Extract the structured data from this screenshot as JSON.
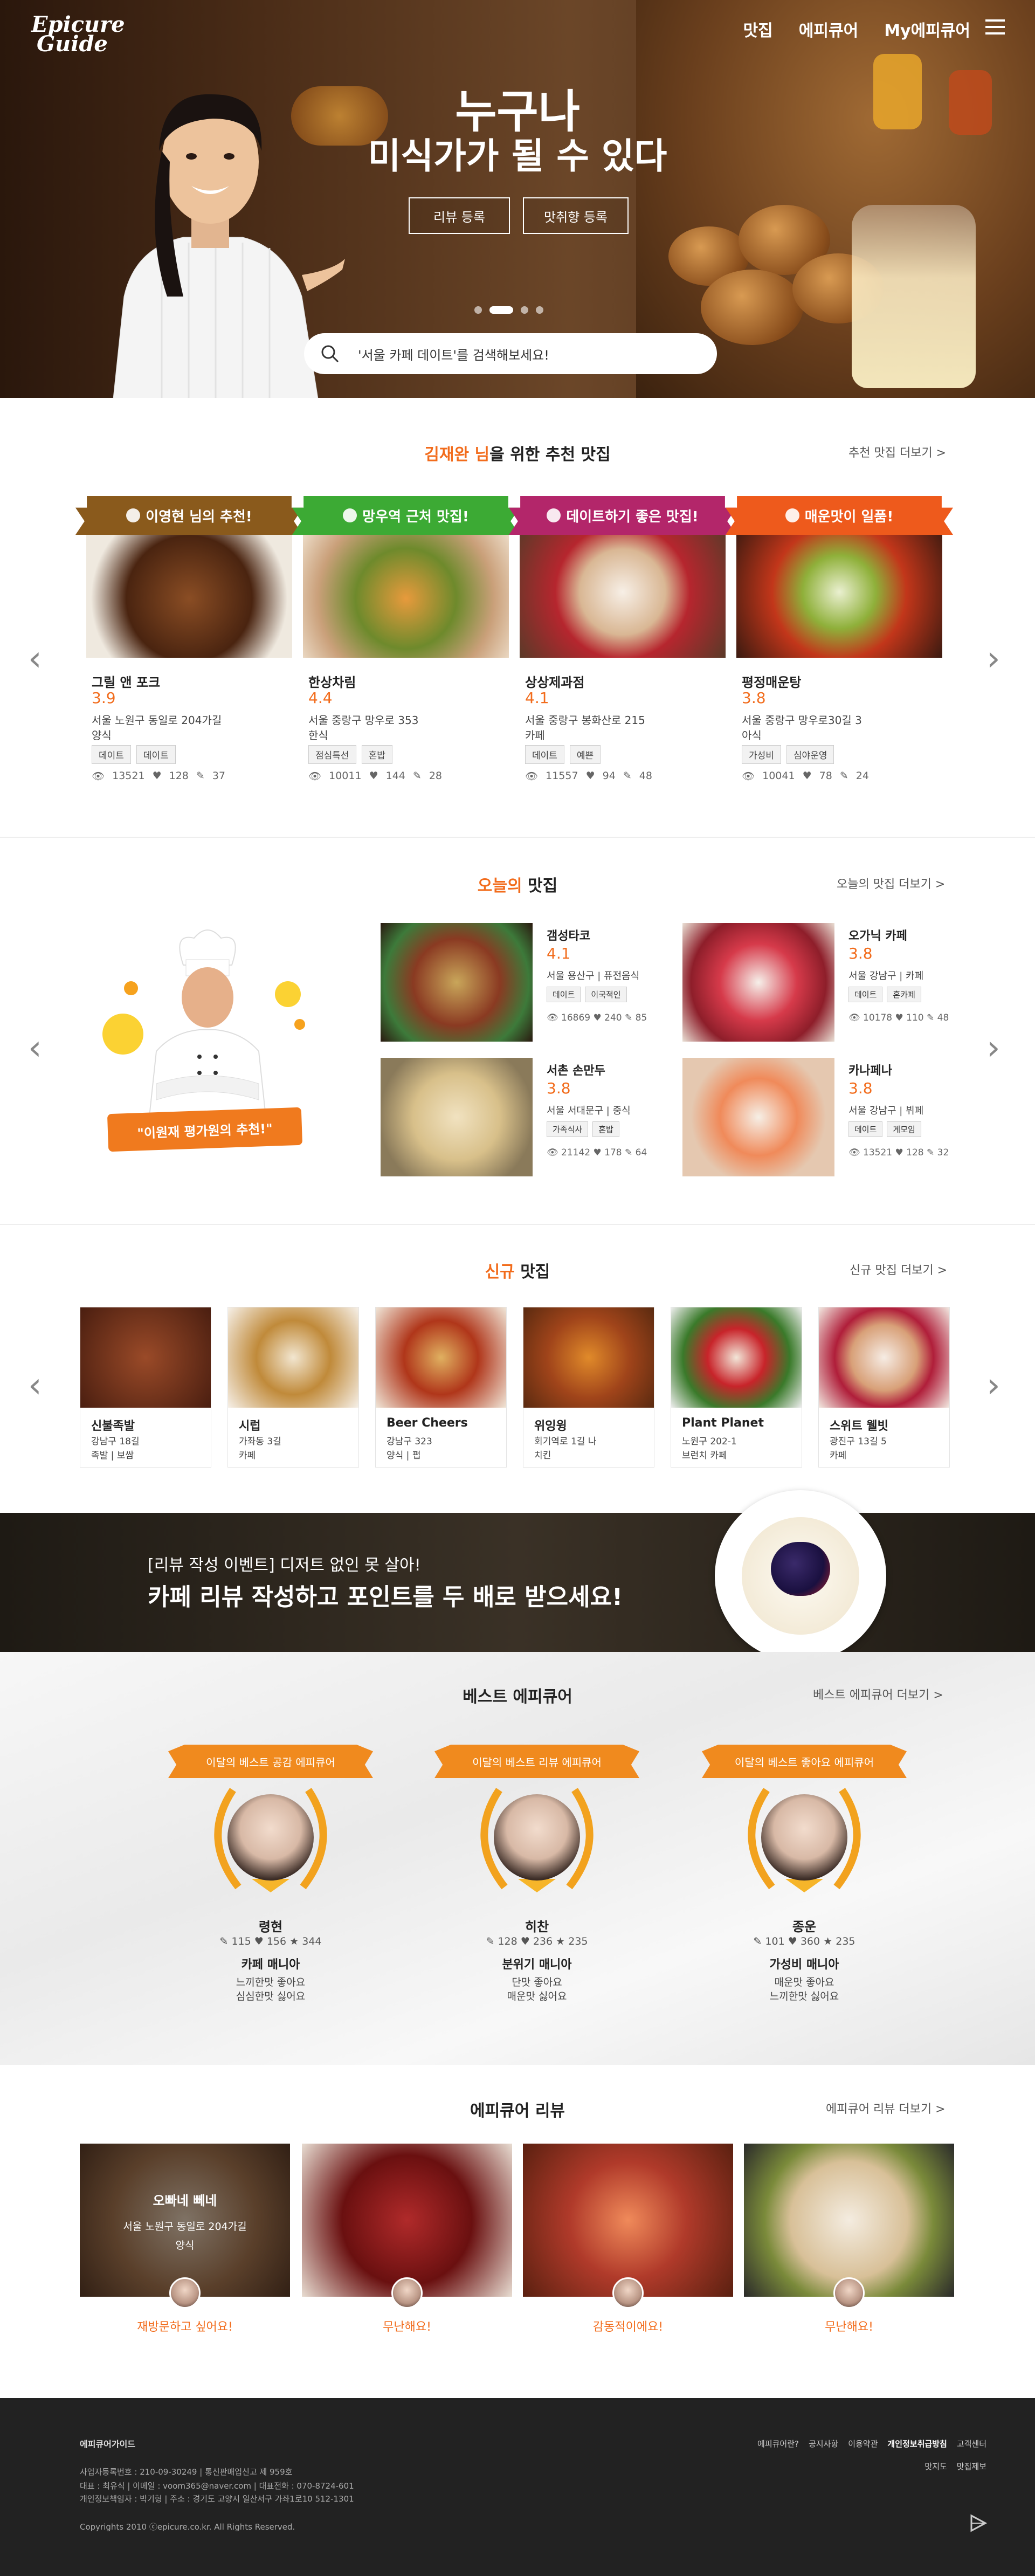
{
  "header": {
    "logo_line1": "Epicure",
    "logo_line2": "Guide",
    "nav": [
      "맛집",
      "에피큐어",
      "My에피큐어"
    ]
  },
  "hero": {
    "title1": "누구나",
    "title2": "미식가가 될 수 있다",
    "btn_review": "리뷰 등록",
    "btn_pref": "맛취향 등록",
    "search_placeholder": "'서울 카페 데이트'를 검색해보세요!"
  },
  "recommend": {
    "title_hl": "김재완 님",
    "title_rest": "을 위한 추천 맛집",
    "more": "추천 맛집 더보기 >",
    "cards": [
      {
        "ribbon": "이영현 님의 추천!",
        "ribbon_color": "#8a5a1c",
        "name": "그릴 앤 포크",
        "rating": "3.9",
        "addr": "서울 노원구 동일로 204가길",
        "cat": "양식",
        "tags": [
          "데이트",
          "데이트"
        ],
        "views": "13521",
        "likes": "128",
        "writes": "37"
      },
      {
        "ribbon": "망우역 근처 맛집!",
        "ribbon_color": "#3caa34",
        "name": "한상차림",
        "rating": "4.4",
        "addr": "서울 중랑구 망우로 353",
        "cat": "한식",
        "tags": [
          "점심특선",
          "혼밥"
        ],
        "views": "10011",
        "likes": "144",
        "writes": "28"
      },
      {
        "ribbon": "데이트하기 좋은 맛집!",
        "ribbon_color": "#b3266a",
        "name": "상상제과점",
        "rating": "4.1",
        "addr": "서울 중랑구 봉화산로 215",
        "cat": "카페",
        "tags": [
          "데이트",
          "예쁜"
        ],
        "views": "11557",
        "likes": "94",
        "writes": "48"
      },
      {
        "ribbon": "매운맛이 일품!",
        "ribbon_color": "#ee5a1c",
        "name": "평정매운탕",
        "rating": "3.8",
        "addr": "서울 중랑구 망우로30길 3",
        "cat": "아식",
        "tags": [
          "가성비",
          "심야운영"
        ],
        "views": "10041",
        "likes": "78",
        "writes": "24"
      }
    ]
  },
  "today": {
    "title_hl": "오늘의",
    "title_rest": " 맛집",
    "more": "오늘의 맛집 더보기 >",
    "chef_caption": "\"이원재 평가원의 추천!\"",
    "cards": [
      {
        "name": "갬성타코",
        "rating": "4.1",
        "addr": "서울 용산구 | 퓨전음식",
        "tags": [
          "데이트",
          "이국적인"
        ],
        "views": "16869",
        "likes": "240",
        "writes": "85"
      },
      {
        "name": "오가닉 카페",
        "rating": "3.8",
        "addr": "서울 강남구 | 카페",
        "tags": [
          "데이트",
          "혼카페"
        ],
        "views": "10178",
        "likes": "110",
        "writes": "48"
      },
      {
        "name": "서촌 손만두",
        "rating": "3.8",
        "addr": "서울 서대문구 | 중식",
        "tags": [
          "가족식사",
          "혼밥"
        ],
        "views": "21142",
        "likes": "178",
        "writes": "64"
      },
      {
        "name": "카나페나",
        "rating": "3.8",
        "addr": "서울 강남구 | 뷔페",
        "tags": [
          "데이트",
          "게모임"
        ],
        "views": "13521",
        "likes": "128",
        "writes": "32"
      }
    ]
  },
  "newest": {
    "title_hl": "신규",
    "title_rest": " 맛집",
    "more": "신규 맛집 더보기 >",
    "cards": [
      {
        "name": "신불족발",
        "addr": "강남구 18길",
        "cat": "족발 | 보쌈"
      },
      {
        "name": "시럽",
        "addr": "가좌동 3길",
        "cat": "카페"
      },
      {
        "name": "Beer Cheers",
        "addr": "강남구 323",
        "cat": "양식 | 펍"
      },
      {
        "name": "위잉윙",
        "addr": "회기역로 1길 나",
        "cat": "치킨"
      },
      {
        "name": "Plant Planet",
        "addr": "노원구 202-1",
        "cat": "브런치 카페"
      },
      {
        "name": "스위트 웰빗",
        "addr": "광진구 13길 5",
        "cat": "카페"
      }
    ]
  },
  "banner": {
    "sub": "[리뷰 작성 이벤트] 디저트 없인 못 살아!",
    "title": "카페 리뷰 작성하고 포인트를 두 배로 받으세요!"
  },
  "best": {
    "title": "베스트 에피큐어",
    "more": "베스트 에피큐어 더보기 >",
    "cards": [
      {
        "ribbon": "이달의 베스트 공감 에피큐어",
        "name": "령현",
        "s1": "115",
        "s2": "156",
        "s3": "344",
        "role": "카페 매니아",
        "like1": "느끼한맛 좋아요",
        "like2": "심심한맛 싫어요"
      },
      {
        "ribbon": "이달의 베스트 리뷰 에피큐어",
        "name": "히찬",
        "s1": "128",
        "s2": "236",
        "s3": "235",
        "role": "분위기 매니아",
        "like1": "단맛 좋아요",
        "like2": "매운맛 싫어요"
      },
      {
        "ribbon": "이달의 베스트 좋아요 에피큐어",
        "name": "종운",
        "s1": "101",
        "s2": "360",
        "s3": "235",
        "role": "가성비 매니아",
        "like1": "매운맛 좋아요",
        "like2": "느끼한맛 싫어요"
      }
    ]
  },
  "reviews": {
    "title": "에피큐어 리뷰",
    "more": "에피큐어 리뷰 더보기 >",
    "overlay_name": "오빠네 뻬네",
    "overlay_addr": "서울 노원구 동일로 204가길",
    "overlay_cat": "양식",
    "captions": [
      "재방문하고 싶어요!",
      "무난해요!",
      "감동적이에요!",
      "무난해요!"
    ]
  },
  "footer": {
    "company": "에피큐어가이드",
    "l1": "사업자등록번호 : 210-09-30249  |  통신판매업신고 제 959호",
    "l2": "대표 : 최유식  |  이메일 : voom365@naver.com  |  대표전화 : 070-8724-601",
    "l3": "개인정보책임자 : 박기형  |  주소 : 경기도 고양시 일산서구 가좌1로10 512-1301",
    "copy": "Copyrights 2010 ⓒepicure.co.kr. All Rights Reserved.",
    "links": [
      "에피큐어란?",
      "공지사항",
      "이용약관",
      "개인정보취급방침",
      "고객센터"
    ],
    "links2": [
      "맛지도",
      "맛집제보"
    ]
  },
  "colors": {
    "accent": "#f26c1c",
    "footer_bg": "#222222"
  }
}
